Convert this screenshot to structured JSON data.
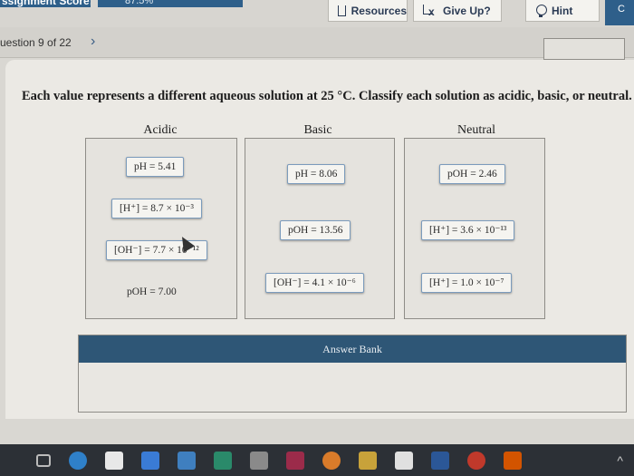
{
  "header": {
    "score_label": "ssignment Score:",
    "score_value": "87.5%",
    "resources_label": "Resources",
    "giveup_label": "Give Up?",
    "giveup_icon_glyph": "x",
    "hint_label": "Hint",
    "extra_label": "C"
  },
  "question_nav": {
    "label": "uestion 9 of 22",
    "chevron": "›"
  },
  "question": {
    "prompt": "Each value represents a different aqueous solution at 25 °C. Classify each solution as acidic, basic, or neutral."
  },
  "columns": {
    "acidic": {
      "title": "Acidic",
      "chips": [
        "pH = 5.41",
        "[H⁺] = 8.7 × 10⁻³",
        "[OH⁻] = 7.7 × 10⁻¹²",
        "pOH = 7.00"
      ]
    },
    "basic": {
      "title": "Basic",
      "chips": [
        "pH = 8.06",
        "pOH = 13.56",
        "[OH⁻] = 4.1 × 10⁻⁶"
      ]
    },
    "neutral": {
      "title": "Neutral",
      "chips": [
        "pOH = 2.46",
        "[H⁺] = 3.6 × 10⁻¹³",
        "[H⁺] = 1.0 × 10⁻⁷"
      ]
    }
  },
  "answer_bank": {
    "title": "Answer Bank"
  },
  "taskbar": {
    "icons": [
      "task-view-icon",
      "edge-icon",
      "store-icon",
      "dropbox-icon",
      "photos-icon",
      "stocks-icon",
      "onenote-icon",
      "app-icon",
      "chrome-icon",
      "app-icon-2",
      "word-icon",
      "app-icon-3",
      "app-icon-4"
    ],
    "chevron": "^"
  },
  "colors": {
    "accent": "#2e5676",
    "chip_border": "#7b9bbc"
  }
}
